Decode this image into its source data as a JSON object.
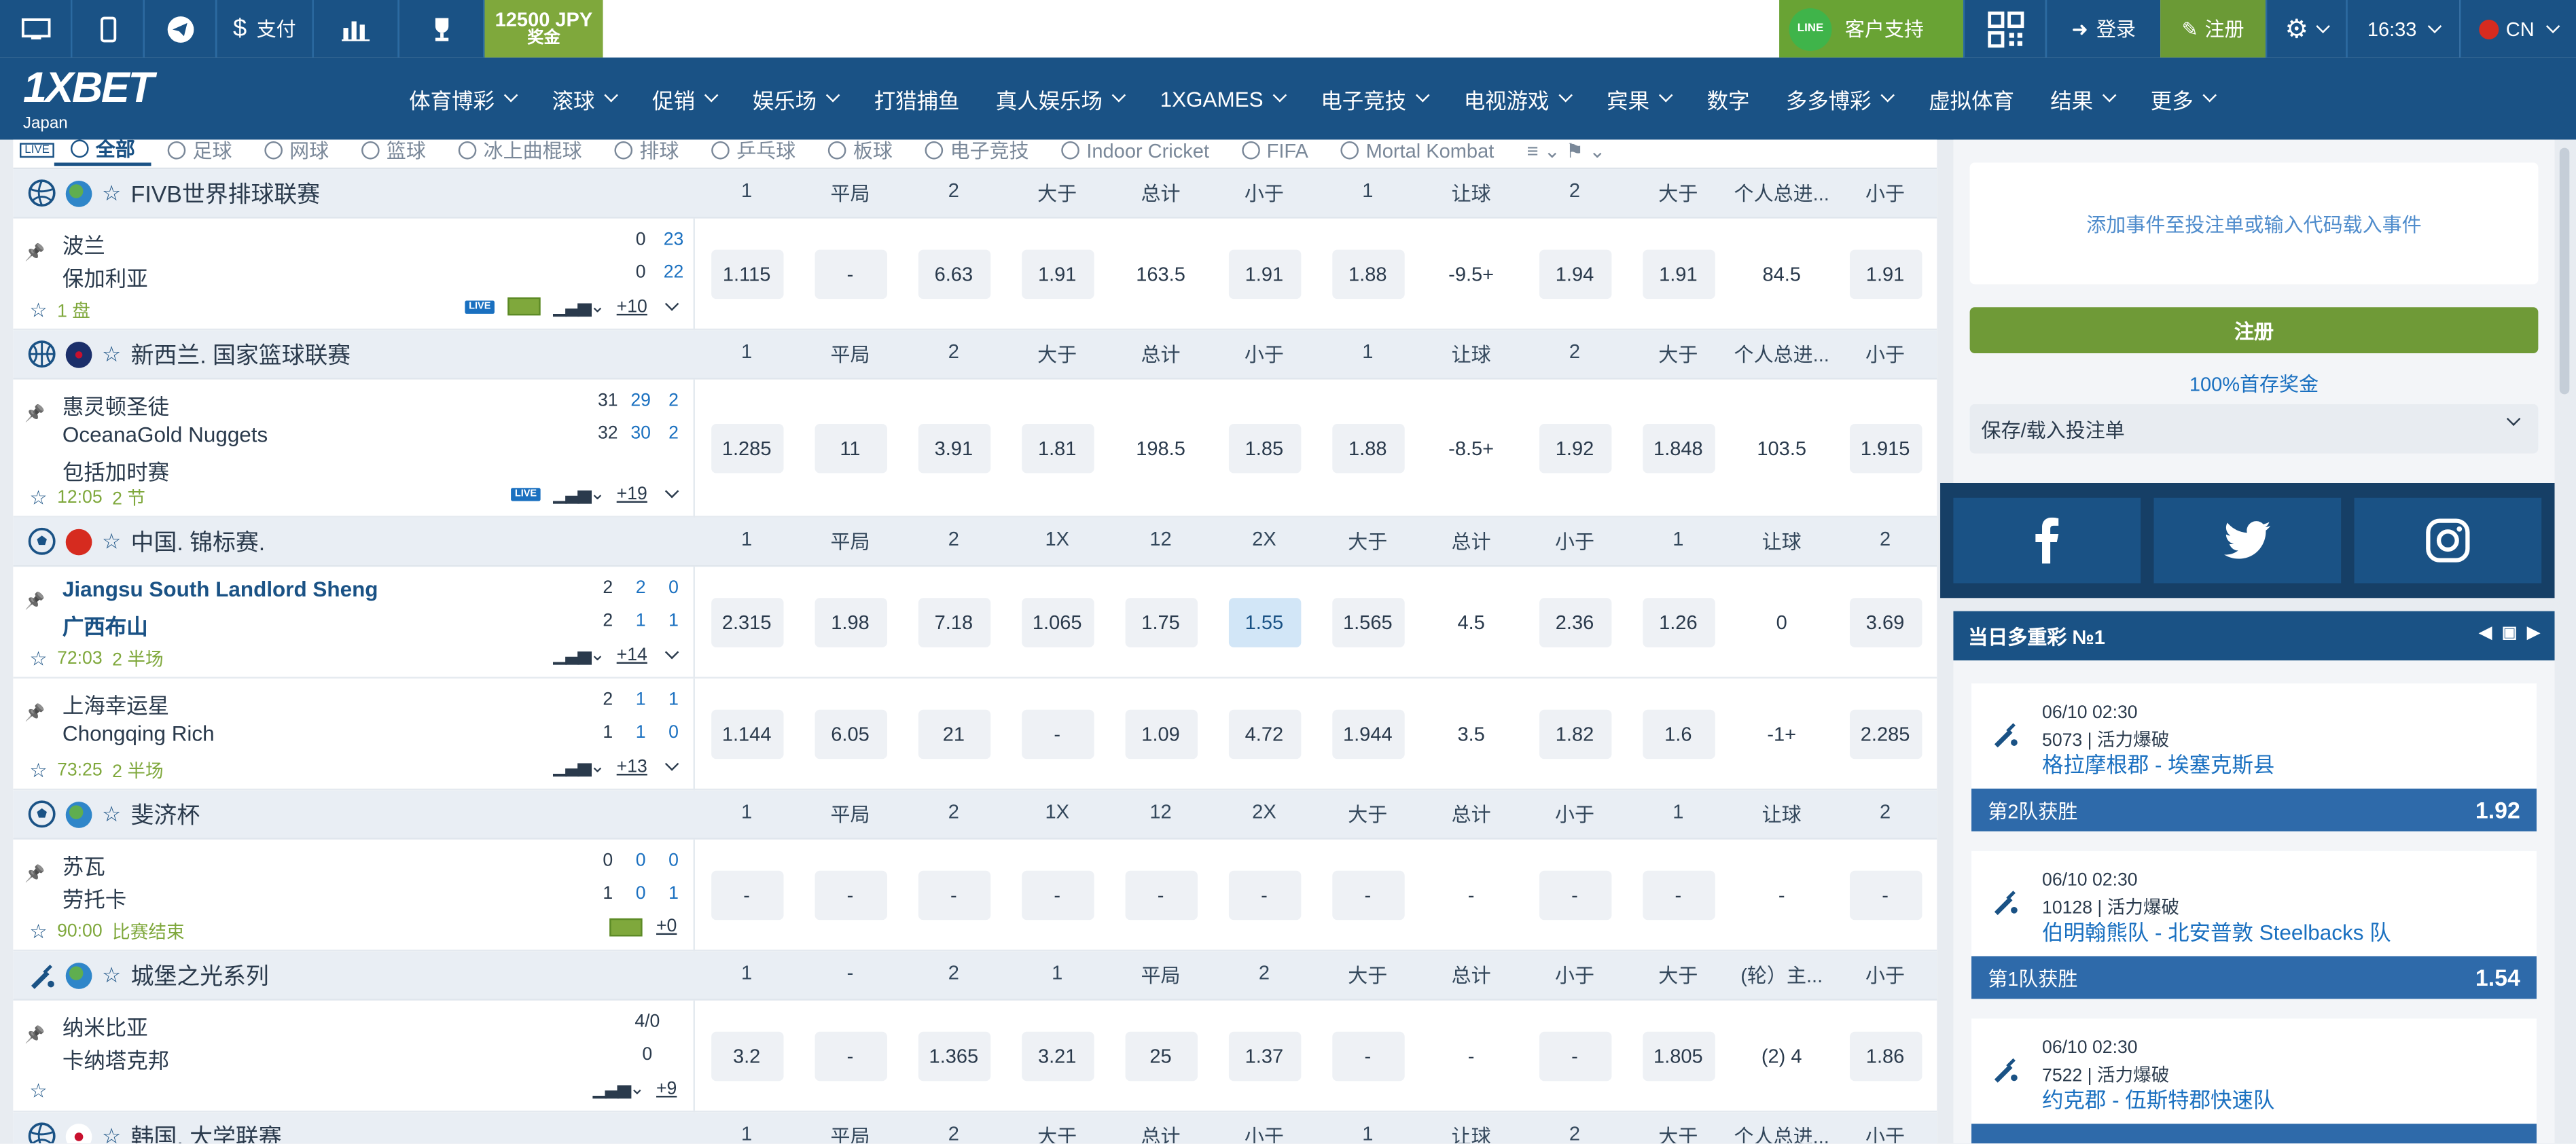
{
  "topbar": {
    "pay_label": "支付",
    "bonus_amount": "12500 JPY",
    "bonus_label": "奖金",
    "support_label": "客户支持",
    "line_badge": "LINE",
    "login_label": "登录",
    "register_label": "注册",
    "time": "16:33",
    "lang": "CN"
  },
  "logo": {
    "brand": "1XBET",
    "region": "Japan"
  },
  "nav": {
    "items": [
      "体育博彩",
      "滚球",
      "促销",
      "娱乐场",
      "打猎捕鱼",
      "真人娱乐场",
      "1XGAMES",
      "电子竞技",
      "电视游戏",
      "宾果",
      "数字",
      "多多博彩",
      "虚拟体育",
      "结果",
      "更多"
    ],
    "dropdown": [
      true,
      true,
      true,
      true,
      false,
      true,
      true,
      true,
      true,
      true,
      false,
      true,
      false,
      true,
      true
    ]
  },
  "sport_tabs": {
    "live": "LIVE",
    "items": [
      "全部",
      "足球",
      "网球",
      "篮球",
      "冰上曲棍球",
      "排球",
      "乒乓球",
      "板球",
      "电子竞技",
      "Indoor Cricket",
      "FIFA",
      "Mortal Kombat"
    ]
  },
  "leagues": [
    {
      "name": "FIVB世界排球联赛",
      "sport": "volleyball",
      "markets": [
        "1",
        "平局",
        "2",
        "大于",
        "总计",
        "小于",
        "1",
        "让球",
        "2",
        "大于",
        "个人总进...",
        "小于"
      ],
      "events": [
        {
          "teams": [
            "波兰",
            "保加利亚"
          ],
          "scores": [
            [
              "0",
              "23"
            ],
            [
              "0",
              "22"
            ]
          ],
          "foot": "1 盘",
          "more": "+10",
          "odds": [
            "1.115",
            "-",
            "6.63",
            "1.91",
            "163.5",
            "1.91",
            "1.88",
            "-9.5+",
            "1.94",
            "1.91",
            "84.5",
            "1.91"
          ]
        }
      ]
    },
    {
      "name": "新西兰. 国家篮球联赛",
      "sport": "basketball",
      "markets": [
        "1",
        "平局",
        "2",
        "大于",
        "总计",
        "小于",
        "1",
        "让球",
        "2",
        "大于",
        "个人总进...",
        "小于"
      ],
      "events": [
        {
          "teams": [
            "惠灵顿圣徒",
            "OceanaGold Nuggets",
            "包括加时赛"
          ],
          "scores": [
            [
              "31",
              "29",
              "2"
            ],
            [
              "32",
              "30",
              "2"
            ]
          ],
          "time": "12:05",
          "foot": "2 节",
          "more": "+19",
          "odds": [
            "1.285",
            "11",
            "3.91",
            "1.81",
            "198.5",
            "1.85",
            "1.88",
            "-8.5+",
            "1.92",
            "1.848",
            "103.5",
            "1.915"
          ]
        }
      ]
    },
    {
      "name": "中国. 锦标赛.",
      "sport": "football",
      "markets": [
        "1",
        "平局",
        "2",
        "1X",
        "12",
        "2X",
        "大于",
        "总计",
        "小于",
        "1",
        "让球",
        "2"
      ],
      "events": [
        {
          "teams": [
            "Jiangsu South Landlord Sheng",
            "广西布山"
          ],
          "scores": [
            [
              "2",
              "2",
              "0"
            ],
            [
              "2",
              "1",
              "1"
            ]
          ],
          "time": "72:03",
          "foot": "2 半场",
          "more": "+14",
          "odds": [
            "2.315",
            "1.98",
            "7.18",
            "1.065",
            "1.75",
            "1.55",
            "1.565",
            "4.5",
            "2.36",
            "1.26",
            "0",
            "3.69"
          ]
        },
        {
          "teams": [
            "上海幸运星",
            "Chongqing Rich"
          ],
          "scores": [
            [
              "2",
              "1",
              "1"
            ],
            [
              "1",
              "1",
              "0"
            ]
          ],
          "time": "73:25",
          "foot": "2 半场",
          "more": "+13",
          "odds": [
            "1.144",
            "6.05",
            "21",
            "-",
            "1.09",
            "4.72",
            "1.944",
            "3.5",
            "1.82",
            "1.6",
            "-1+",
            "2.285"
          ]
        }
      ]
    },
    {
      "name": "斐济杯",
      "sport": "football",
      "markets": [
        "1",
        "平局",
        "2",
        "1X",
        "12",
        "2X",
        "大于",
        "总计",
        "小于",
        "1",
        "让球",
        "2"
      ],
      "events": [
        {
          "teams": [
            "苏瓦",
            "劳托卡"
          ],
          "scores": [
            [
              "0",
              "0",
              "0"
            ],
            [
              "1",
              "0",
              "1"
            ]
          ],
          "time": "90:00",
          "foot": "比赛结束",
          "more": "+0",
          "odds": [
            "-",
            "-",
            "-",
            "-",
            "-",
            "-",
            "-",
            "-",
            "-",
            "-",
            "-",
            "-"
          ]
        }
      ]
    },
    {
      "name": "城堡之光系列",
      "sport": "cricket",
      "markets": [
        "1",
        "-",
        "2",
        "1",
        "平局",
        "2",
        "大于",
        "总计",
        "小于",
        "大于",
        "(轮）主...",
        "小于"
      ],
      "events": [
        {
          "teams": [
            "纳米比亚",
            "卡纳塔克邦"
          ],
          "scores": [
            [
              "4/0"
            ],
            [
              "0"
            ]
          ],
          "more": "+9",
          "odds": [
            "3.2",
            "-",
            "1.365",
            "3.21",
            "25",
            "1.37",
            "-",
            "-",
            "-",
            "1.805",
            "(2) 4",
            "1.86"
          ]
        }
      ]
    },
    {
      "name": "韩国. 大学联赛",
      "sport": "volleyball",
      "markets": [
        "1",
        "平局",
        "2",
        "大于",
        "总计",
        "小于",
        "1",
        "让球",
        "2",
        "大于",
        "个人总进...",
        "小于"
      ],
      "events": []
    }
  ],
  "sidebar": {
    "coupon_hint": "添加事件至投注单或输入代码载入事件",
    "register": "注册",
    "bonus": "100%首存奖金",
    "save_load": "保存/载入投注单",
    "accumulator_title": "当日多重彩 №1",
    "cards": [
      {
        "date": "06/10 02:30",
        "info": "5073 | 活力爆破",
        "match": "格拉摩根郡 - 埃塞克斯县",
        "bet": "第2队获胜",
        "odd": "1.92"
      },
      {
        "date": "06/10 02:30",
        "info": "10128 | 活力爆破",
        "match": "伯明翰熊队 - 北安普敦 Steelbacks 队",
        "bet": "第1队获胜",
        "odd": "1.54"
      },
      {
        "date": "06/10 02:30",
        "info": "7522 | 活力爆破",
        "match": "约克郡 - 伍斯特郡快速队",
        "bet": "",
        "odd": ""
      }
    ]
  },
  "colors": {
    "primary": "#1a5285",
    "green": "#7fa83c",
    "selected_odd": "#d2e6f7"
  }
}
